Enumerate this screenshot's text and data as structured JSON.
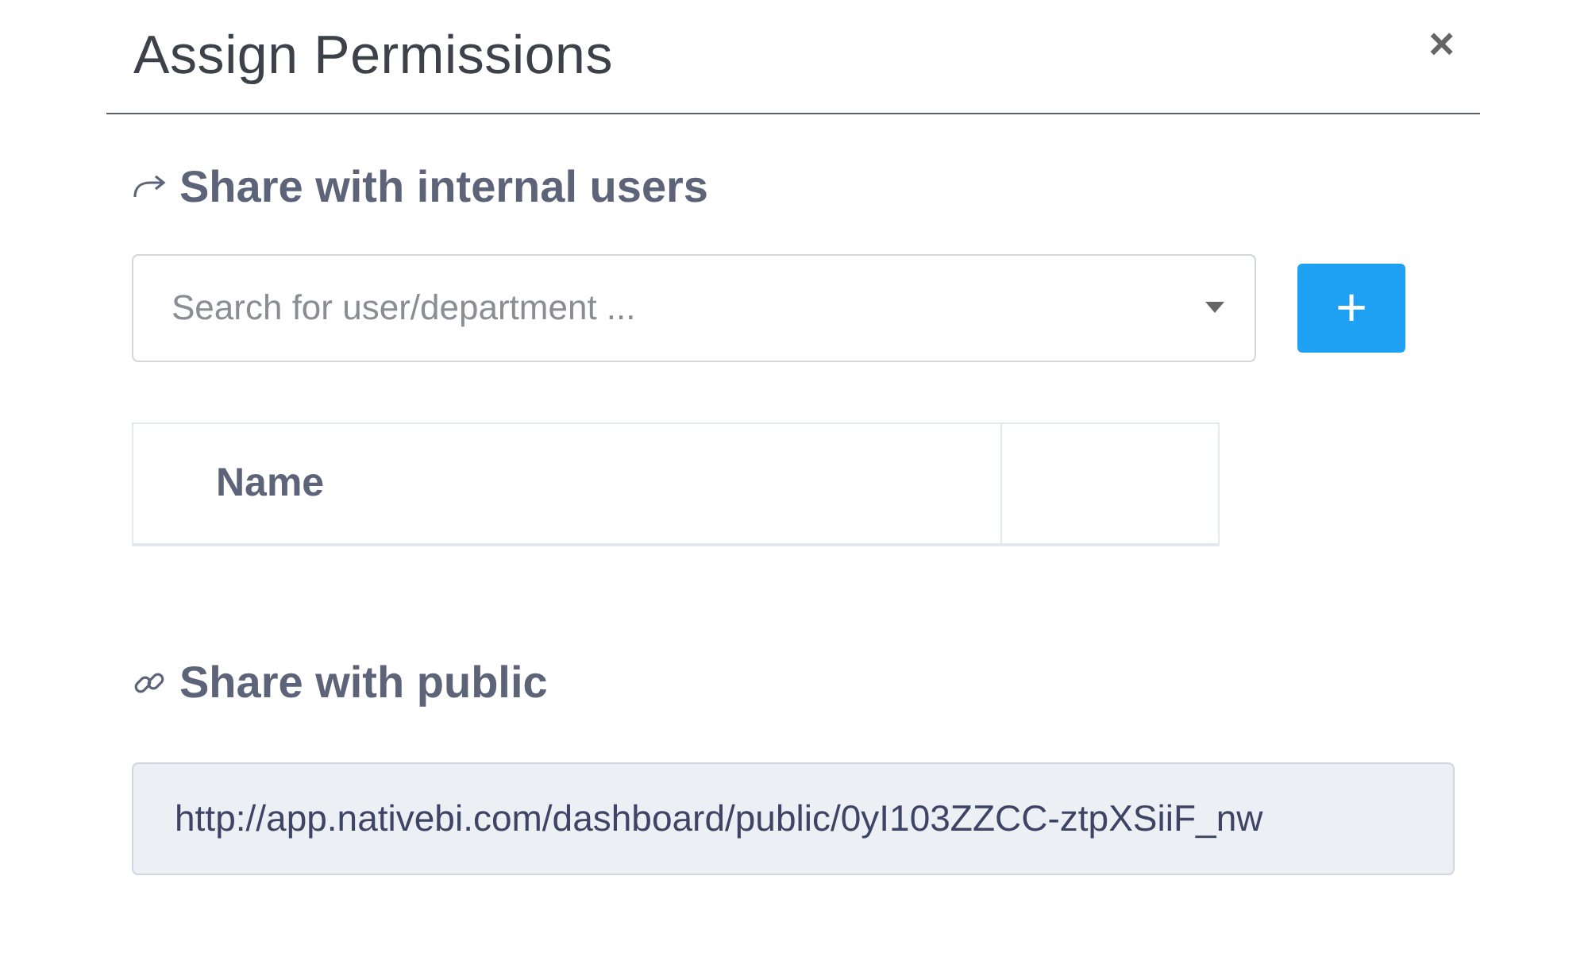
{
  "dialog": {
    "title": "Assign Permissions",
    "close": "×"
  },
  "internal": {
    "heading": "Share with internal users",
    "search": {
      "placeholder": "Search for user/department ..."
    },
    "add_button": "+",
    "table": {
      "columns": [
        "Name"
      ]
    }
  },
  "public": {
    "heading": "Share with public",
    "url": "http://app.nativebi.com/dashboard/public/0yI103ZZCC-ztpXSiiF_nw"
  }
}
